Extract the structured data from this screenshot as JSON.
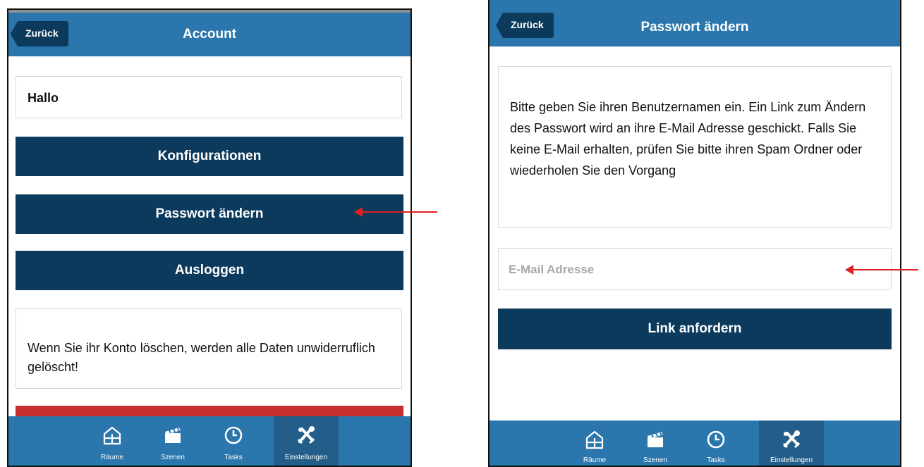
{
  "left_screen": {
    "header": {
      "back_label": "Zurück",
      "title": "Account"
    },
    "greeting": "Hallo",
    "buttons": {
      "configurations": "Konfigurationen",
      "change_password": "Passwort ändern",
      "logout": "Ausloggen"
    },
    "delete_warning": "Wenn Sie ihr Konto löschen, werden alle Daten unwiderruflich gelöscht!",
    "delete_button_color": "#c62f2f"
  },
  "right_screen": {
    "header": {
      "back_label": "Zurück",
      "title": "Passwort ändern"
    },
    "info_text": "Bitte geben Sie ihren Benutzernamen ein. Ein Link zum Ändern des Passwort wird an ihre E-Mail Adresse geschickt. Falls Sie keine E-Mail erhalten, prüfen Sie bitte ihren Spam Ordner oder wiederholen Sie den Vorgang",
    "email_placeholder": "E-Mail Adresse",
    "request_link_button": "Link anfordern"
  },
  "tabbar": {
    "tabs": [
      {
        "label": "Räume",
        "icon": "house-icon"
      },
      {
        "label": "Szenen",
        "icon": "clapperboard-icon"
      },
      {
        "label": "Tasks",
        "icon": "clock-icon"
      },
      {
        "label": "Einstellungen",
        "icon": "tools-icon",
        "active": true
      }
    ]
  },
  "colors": {
    "header_blue": "#2a76ad",
    "button_navy": "#0c3a5c",
    "annotation_arrow": "#e02020"
  }
}
